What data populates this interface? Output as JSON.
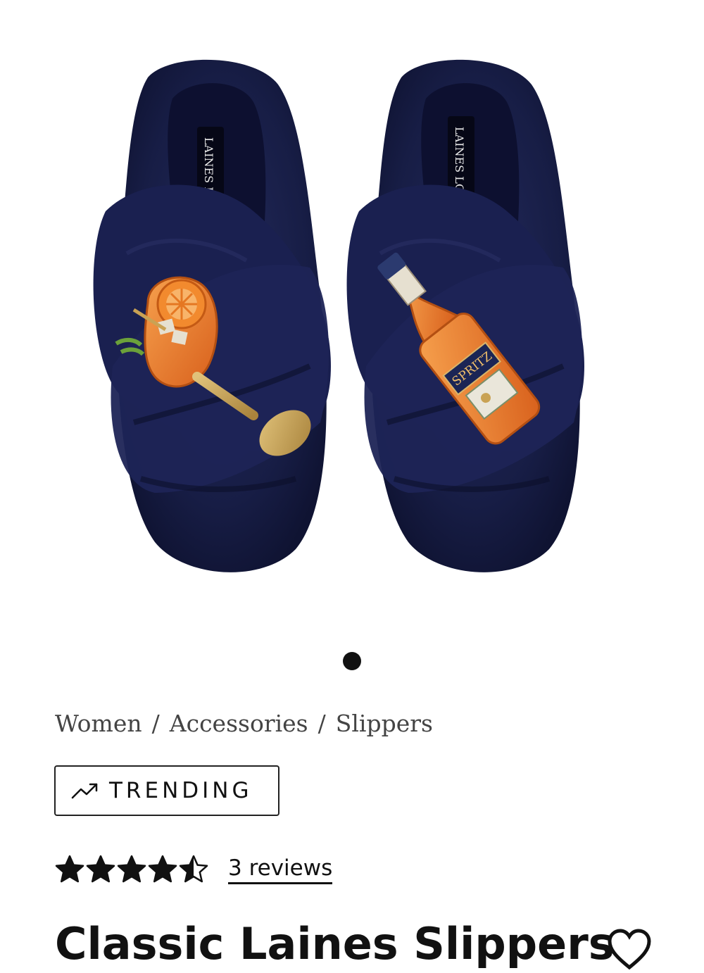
{
  "product_image": {
    "alt": "",
    "brand_mark_left": "LAINES LONDON",
    "brand_mark_right": "LAINES LONDON",
    "bottle_label": "SPRITZ"
  },
  "carousel": {
    "total": 1,
    "active": 1
  },
  "breadcrumb": {
    "items": [
      "Women",
      "Accessories",
      "Slippers"
    ],
    "separator": "/"
  },
  "badge": {
    "label": "TRENDING",
    "icon": "trending-up-icon"
  },
  "rating": {
    "value": 4.5,
    "max": 5,
    "reviews_label": "3 reviews"
  },
  "product": {
    "title": "Classic Laines Slippers"
  },
  "colors": {
    "slipper_navy": "#171d45",
    "accent_orange": "#e8742a",
    "gold": "#c9a254",
    "text": "#111111"
  }
}
